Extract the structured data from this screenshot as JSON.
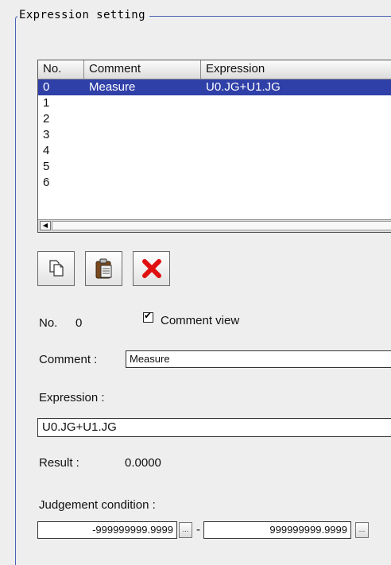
{
  "group": {
    "title": "Expression setting"
  },
  "table": {
    "headers": [
      "No.",
      "Comment",
      "Expression"
    ],
    "rows": [
      {
        "no": "0",
        "comment": "Measure",
        "expression": "U0.JG+U1.JG",
        "selected": true
      },
      {
        "no": "1",
        "comment": "",
        "expression": ""
      },
      {
        "no": "2",
        "comment": "",
        "expression": ""
      },
      {
        "no": "3",
        "comment": "",
        "expression": ""
      },
      {
        "no": "4",
        "comment": "",
        "expression": ""
      },
      {
        "no": "5",
        "comment": "",
        "expression": ""
      },
      {
        "no": "6",
        "comment": "",
        "expression": ""
      }
    ],
    "scroll_left_glyph": "◀"
  },
  "toolbar": {
    "copy_icon": "copy-icon",
    "paste_icon": "paste-icon",
    "delete_icon": "delete-icon"
  },
  "details": {
    "no_label": "No.",
    "no_value": "0",
    "comment_view_label": "Comment view",
    "comment_view_checked": true,
    "check_glyph": "✔",
    "comment_label": "Comment :",
    "comment_value": "Measure",
    "expression_label": "Expression :",
    "expression_value": "U0.JG+U1.JG",
    "result_label": "Result :",
    "result_value": "0.0000",
    "judgement_label": "Judgement condition :",
    "judgement_min": "-999999999.9999",
    "judgement_sep": "-",
    "judgement_max": "999999999.9999",
    "ellipsis": "..."
  },
  "colors": {
    "selection": "#2f40a8",
    "frame": "#4a63b5",
    "delete_red": "#e01010"
  }
}
